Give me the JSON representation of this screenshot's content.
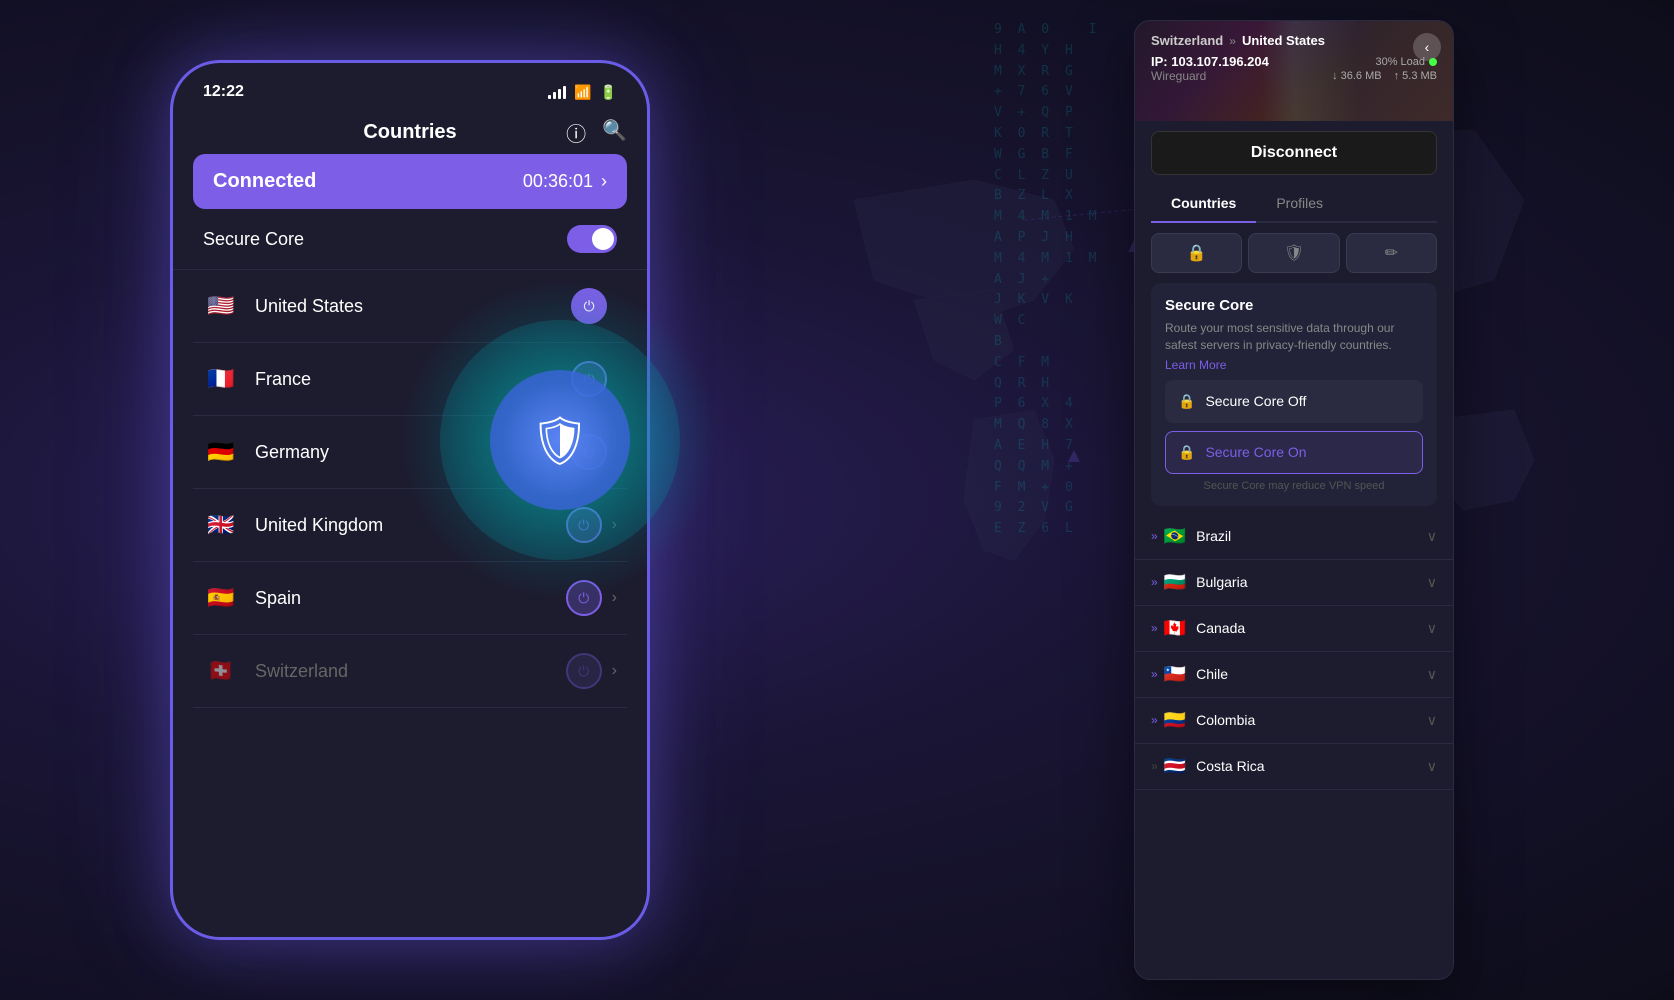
{
  "page": {
    "background_color": "#1a1535"
  },
  "phone": {
    "status_bar": {
      "time": "12:22",
      "signal_icon": "signal",
      "wifi_icon": "wifi",
      "battery_icon": "battery"
    },
    "header": {
      "title": "Countries",
      "info_icon": "info-circle",
      "search_icon": "search"
    },
    "connected_banner": {
      "status": "Connected",
      "time": "00:36:01",
      "chevron": "›"
    },
    "secure_core": {
      "label": "Secure Core",
      "enabled": true
    },
    "countries": [
      {
        "name": "United States",
        "flag": "🇺🇸",
        "active": true
      },
      {
        "name": "France",
        "flag": "🇫🇷",
        "active": false
      },
      {
        "name": "Germany",
        "flag": "🇩🇪",
        "active": false
      },
      {
        "name": "United Kingdom",
        "flag": "🇬🇧",
        "active": false
      },
      {
        "name": "Spain",
        "flag": "🇪🇸",
        "active": false
      },
      {
        "name": "Switzerland",
        "flag": "🇨🇭",
        "active": false,
        "dimmed": true
      }
    ]
  },
  "desktop_panel": {
    "breadcrumb": {
      "from": "Switzerland",
      "arrow": "»",
      "to": "United States"
    },
    "back_button": "‹",
    "ip_label": "IP:",
    "ip_address": "103.107.196.204",
    "load_label": "30% Load",
    "protocol": "Wireguard",
    "download": "↓ 36.6 MB",
    "upload": "↑ 5.3 MB",
    "disconnect_label": "Disconnect",
    "tabs": [
      {
        "label": "Countries",
        "active": true
      },
      {
        "label": "Profiles",
        "active": false
      }
    ],
    "filter_buttons": [
      {
        "icon": "🔒",
        "active": false
      },
      {
        "icon": "🛡",
        "active": false
      },
      {
        "icon": "✏️",
        "active": false
      }
    ],
    "secure_core": {
      "title": "Secure Core",
      "description": "Route your most sensitive data through our safest servers in privacy-friendly countries.",
      "learn_more": "Learn More",
      "options": [
        {
          "label": "Secure Core Off",
          "selected": false
        },
        {
          "label": "Secure Core On",
          "selected": true
        }
      ],
      "note": "Secure Core may reduce VPN speed"
    },
    "countries": [
      {
        "name": "Brazil",
        "flag": "🇧🇷"
      },
      {
        "name": "Bulgaria",
        "flag": "🇧🇬"
      },
      {
        "name": "Canada",
        "flag": "🇨🇦"
      },
      {
        "name": "Chile",
        "flag": "🇨🇱"
      },
      {
        "name": "Colombia",
        "flag": "🇨🇴"
      },
      {
        "name": "Costa Rica",
        "flag": "🇨🇷"
      }
    ]
  },
  "matrix": {
    "text": "9 A 0\nH 4 Y H\nM X R G\n+ 7 6 V\nV + Q P\nK 0 R T\nW G B F\nC L Z U\nB Z L X\nM 4 M 1 M\nA P J H\nM 4 M 1 M\nA J + \nJ K V\nK W C\nB \nC F M\nQ R H \nP 6 X 4\nM Q 8 X\nA E H 7\nQ Q M +\nF M + 0\n- 6 W\n9 Z V G X\nE Z 6 L\nA E H 7"
  }
}
